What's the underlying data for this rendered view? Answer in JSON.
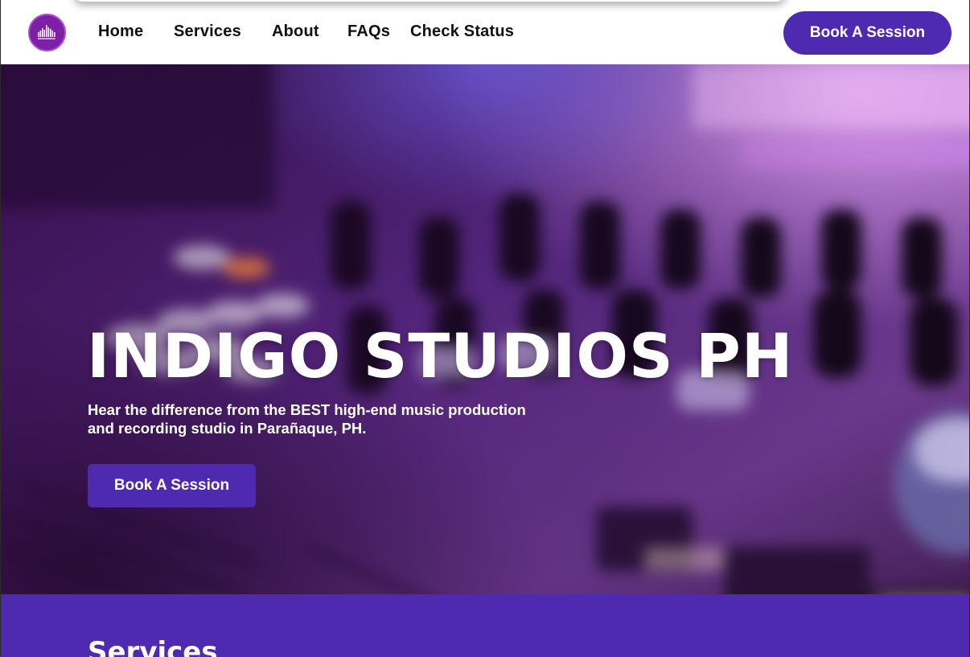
{
  "nav": {
    "links": [
      "Home",
      "Services",
      "About",
      "FAQs",
      "Check Status"
    ],
    "cta_label": "Book A Session"
  },
  "hero": {
    "title": "INDIGO STUDIOS PH",
    "subtitle_line1": "Hear the difference from the BEST high-end music production",
    "subtitle_line2": "and recording studio in Parañaque, PH.",
    "cta_label": "Book A Session"
  },
  "services": {
    "title": "Services"
  },
  "colors": {
    "brand": "#4d2ab0",
    "logo": "#7e1fa8",
    "nav_text": "#111111",
    "hero_text": "#ffffff"
  },
  "icons": {
    "logo": "equalizer-logo-icon"
  }
}
